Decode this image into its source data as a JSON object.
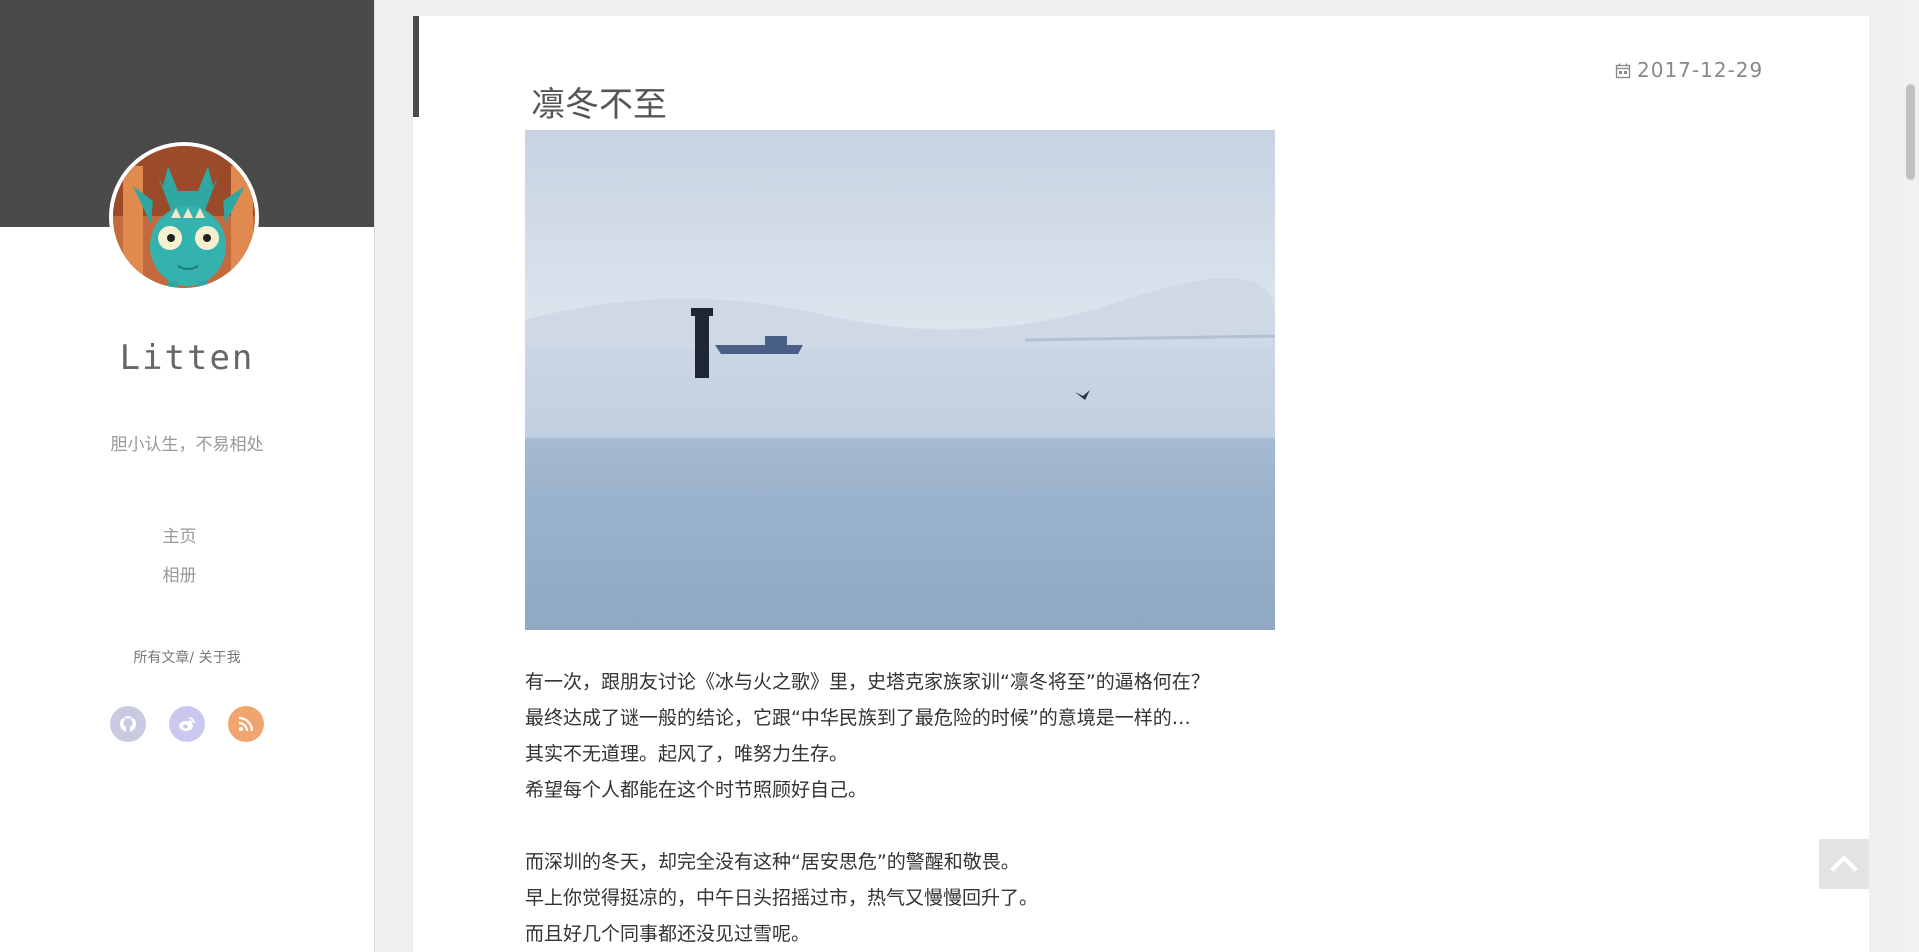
{
  "sidebar": {
    "site_title": "Litten",
    "tagline": "胆小认生，不易相处",
    "nav": [
      {
        "label": "主页"
      },
      {
        "label": "相册"
      }
    ],
    "sub_links": {
      "all_posts": "所有文章",
      "separator": "/",
      "about": "关于我"
    },
    "social": [
      {
        "icon": "github-icon",
        "color": "#c7cbe2"
      },
      {
        "icon": "weibo-icon",
        "color": "#c9c9f0"
      },
      {
        "icon": "rss-icon",
        "color": "#f0a56f"
      }
    ]
  },
  "post": {
    "title": "凛冬不至",
    "date": "2017-12-29",
    "paragraphs": [
      [
        "有一次，跟朋友讨论《冰与火之歌》里，史塔克家族家训“凛冬将至”的逼格何在？",
        "最终达成了谜一般的结论，它跟“中华民族到了最危险的时候”的意境是一样的…",
        "其实不无道理。起风了，唯努力生存。",
        "希望每个人都能在这个时节照顾好自己。"
      ],
      [
        "而深圳的冬天，却完全没有这种“居安思危”的警醒和敬畏。",
        "早上你觉得挺凉的，中午日头招摇过市，热气又慢慢回升了。",
        "而且好几个同事都还没见过雪呢。"
      ]
    ]
  },
  "colors": {
    "sidebar_header": "#4a4a4a",
    "accent": "#4a4a4a",
    "page_bg": "#eef0ef"
  }
}
